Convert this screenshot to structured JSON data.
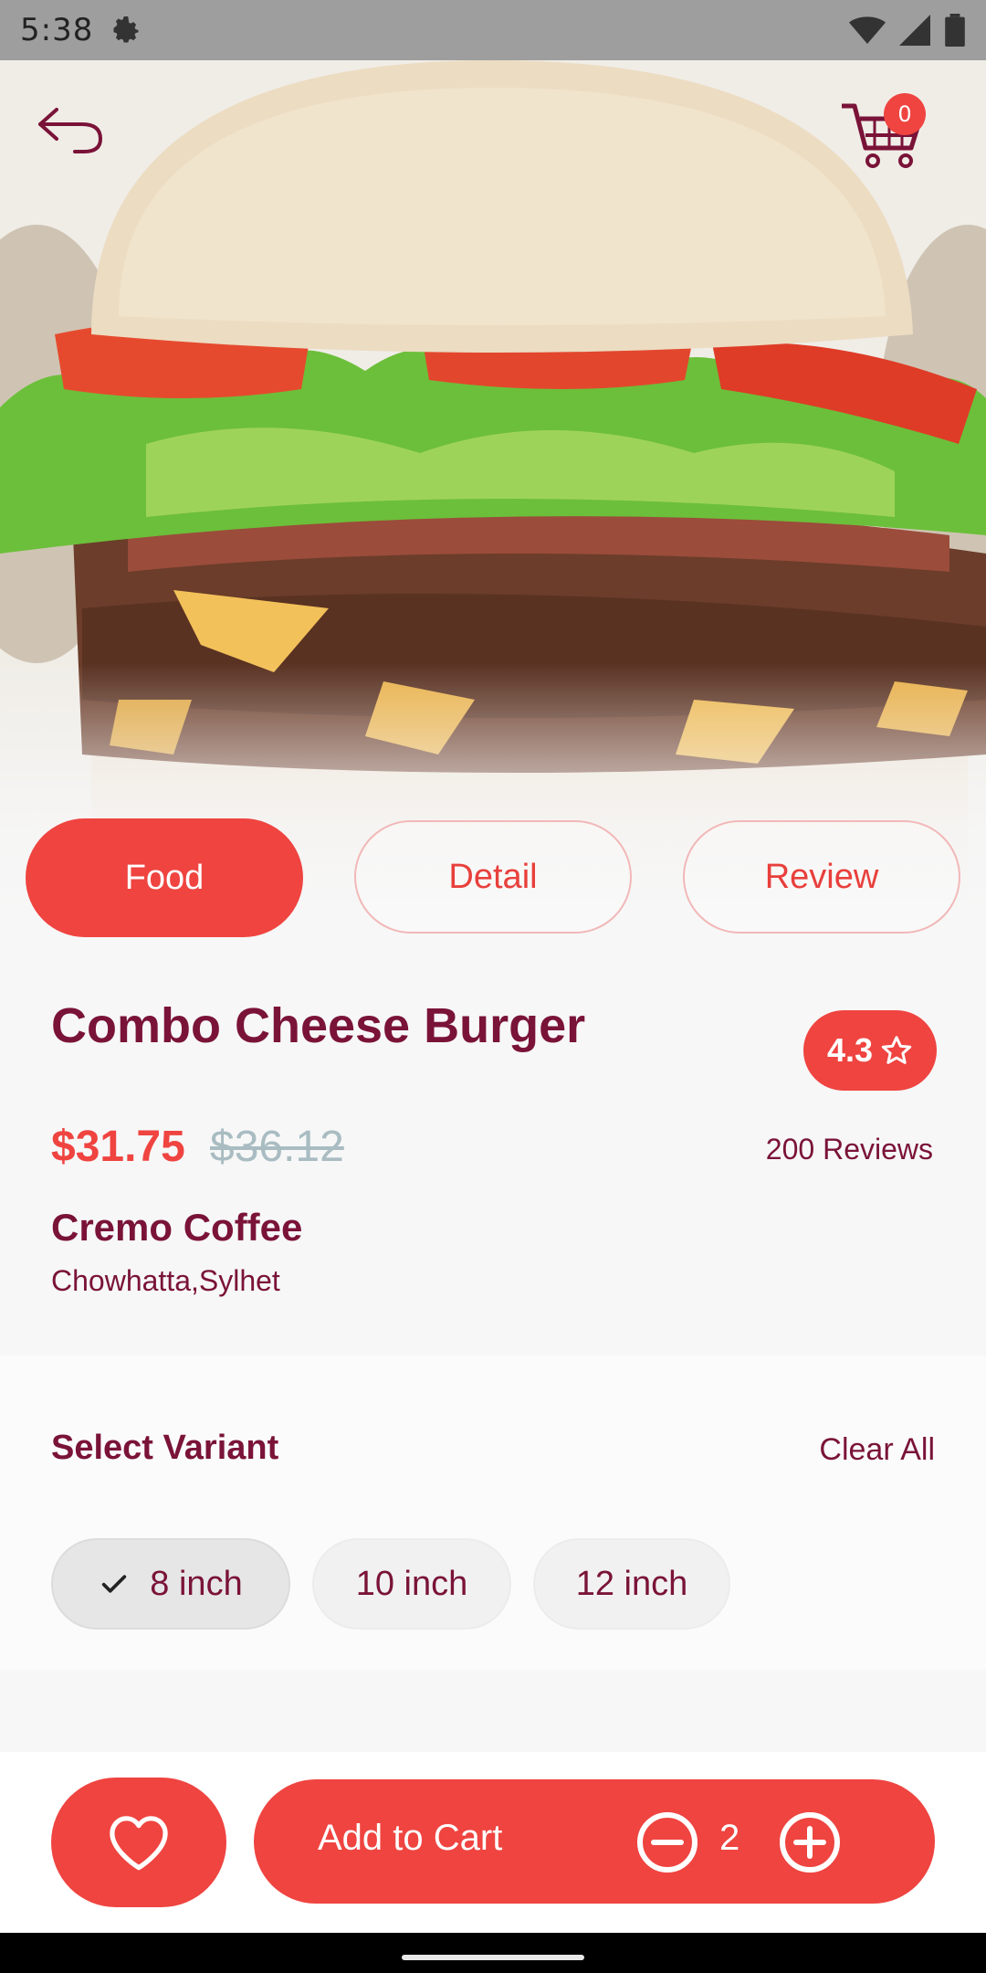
{
  "status_bar": {
    "time": "5:38"
  },
  "header": {
    "cart_count": "0"
  },
  "tabs": [
    {
      "label": "Food"
    },
    {
      "label": "Detail"
    },
    {
      "label": "Review"
    }
  ],
  "product": {
    "title": "Combo Cheese Burger",
    "rating": "4.3",
    "price": "$31.75",
    "old_price": "$36.12",
    "reviews": "200 Reviews",
    "shop": "Cremo Coffee",
    "location": "Chowhatta,Sylhet"
  },
  "variants": {
    "title": "Select Variant",
    "clear_label": "Clear All",
    "options": [
      {
        "label": "8 inch",
        "selected": true
      },
      {
        "label": "10 inch",
        "selected": false
      },
      {
        "label": "12 inch",
        "selected": false
      }
    ]
  },
  "bottom": {
    "add_label": "Add to Cart",
    "quantity": "2"
  },
  "colors": {
    "accent": "#ef4440",
    "text_primary": "#7a1338",
    "old_price": "#a9bcc2"
  },
  "icons": [
    "settings-icon",
    "wifi-icon",
    "signal-icon",
    "battery-icon",
    "back-arrow-icon",
    "cart-icon",
    "star-icon",
    "check-icon",
    "heart-icon",
    "minus-circle-icon",
    "plus-circle-icon"
  ]
}
